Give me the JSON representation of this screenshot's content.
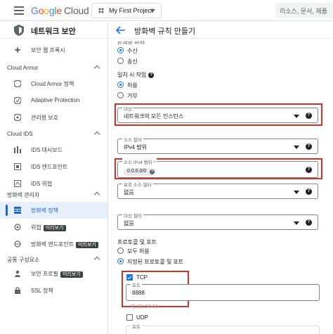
{
  "topbar": {
    "logo": [
      "G",
      "o",
      "o",
      "g",
      "l",
      "e"
    ],
    "logo_suffix": "Cloud",
    "project": "My First Project",
    "search_placeholder": "리소스, 문서, 제품"
  },
  "sidebar": {
    "title": "네트워크 보안",
    "items": [
      {
        "label": "보안 웹 프록시",
        "icon": "proxy-icon"
      },
      {
        "section": "Cloud Armor"
      },
      {
        "label": "Cloud Armor 정책",
        "icon": "armor-shield-icon"
      },
      {
        "label": "Adaptive Protection",
        "icon": "adaptive-shield-icon"
      },
      {
        "label": "관리형 보호",
        "icon": "managed-shield-icon"
      },
      {
        "section": "Cloud IDS"
      },
      {
        "label": "IDS 대시보드",
        "icon": "dashboard-icon"
      },
      {
        "label": "IDS 엔드포인트",
        "icon": "endpoint-icon"
      },
      {
        "label": "IDS 위협",
        "icon": "threat-icon"
      },
      {
        "section": "방화벽 관리자"
      },
      {
        "label": "방화벽 정책",
        "icon": "firewall-icon",
        "active": true
      },
      {
        "label": "위협",
        "icon": "threat-icon",
        "badge": "미리보기"
      },
      {
        "label": "방화벽 엔드포인트",
        "icon": "endpoint-icon",
        "badge": "미리보기"
      },
      {
        "section": "공통 구성요소"
      },
      {
        "label": "보안 프로필",
        "icon": "profile-icon",
        "badge": "미리보기"
      },
      {
        "label": "SSL 정책",
        "icon": "ssl-icon"
      }
    ]
  },
  "page": {
    "title": "방화벽 규칙 만들기"
  },
  "form": {
    "direction": {
      "label": "트래픽 방향",
      "options": [
        "수신",
        "송신"
      ],
      "selected": 0
    },
    "action": {
      "label": "일치 시 작업",
      "options": [
        "허용",
        "거부"
      ],
      "selected": 0
    },
    "target": {
      "label": "대상",
      "value": "네트워크의 모든 인스턴스"
    },
    "source_filter": {
      "label": "소스 필터",
      "value": "IPv4 범위"
    },
    "source_ipv4": {
      "label": "소스 IPv4 범위 *",
      "chip": "0.0.0.0/0"
    },
    "secondary_filter": {
      "label": "보조 소스 필터",
      "value": "없음"
    },
    "dest_filter": {
      "label": "대상 필터",
      "value": "없음"
    },
    "protocols": {
      "label": "프로토콜 및 포트",
      "options": [
        "모두 허용",
        "지정된 프로토콜 및 포트"
      ],
      "selected": 1,
      "tcp": {
        "label": "TCP",
        "checked": true,
        "port_label": "포트",
        "port_value": "8888",
        "hint": "예: 20, 50-60"
      },
      "udp": {
        "label": "UDP",
        "checked": false,
        "port_label": "포트"
      }
    }
  }
}
